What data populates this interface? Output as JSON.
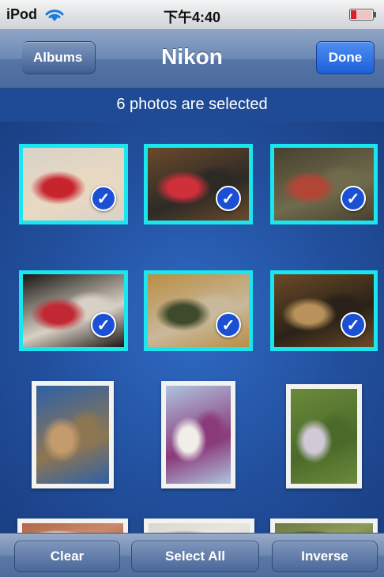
{
  "status_bar": {
    "carrier": "iPod",
    "time": "下午4:40",
    "wifi_icon": "wifi-icon",
    "battery_icon": "battery-icon"
  },
  "nav": {
    "back_label": "Albums",
    "title": "Nikon",
    "done_label": "Done"
  },
  "banner": {
    "text": "6 photos are selected"
  },
  "grid": {
    "photos": [
      {
        "selected": true,
        "colors": [
          "#d9d2c8",
          "#c8242d",
          "#e9d9c2"
        ]
      },
      {
        "selected": true,
        "colors": [
          "#6b4a2b",
          "#d0303a",
          "#2d2a26"
        ]
      },
      {
        "selected": true,
        "colors": [
          "#48402f",
          "#b34537",
          "#6f6b4c"
        ]
      },
      {
        "selected": true,
        "colors": [
          "#1a1612",
          "#c12834",
          "#d7d0c4"
        ]
      },
      {
        "selected": true,
        "colors": [
          "#b98e45",
          "#3e4a2a",
          "#c9b89a"
        ]
      },
      {
        "selected": true,
        "colors": [
          "#6a4a26",
          "#b8925a",
          "#2a2218"
        ]
      },
      {
        "selected": false,
        "colors": [
          "#2f60a6",
          "#c49b6c",
          "#8d7652"
        ]
      },
      {
        "selected": false,
        "colors": [
          "#aec4de",
          "#f0eee8",
          "#8a3a7a"
        ]
      },
      {
        "selected": false,
        "colors": [
          "#6c8a3a",
          "#d1c9d6",
          "#4a6a2a"
        ]
      },
      {
        "selected": false,
        "colors": [
          "#b0664a",
          "#e9dccb",
          "#c98a6a"
        ]
      },
      {
        "selected": false,
        "colors": [
          "#d9d7cf",
          "#b4b4ad",
          "#e9e6df"
        ]
      },
      {
        "selected": false,
        "colors": [
          "#6a7a44",
          "#4f5e36",
          "#8d9a5a"
        ]
      }
    ],
    "check_glyph": "✓"
  },
  "toolbar": {
    "clear_label": "Clear",
    "select_all_label": "Select All",
    "inverse_label": "Inverse"
  }
}
